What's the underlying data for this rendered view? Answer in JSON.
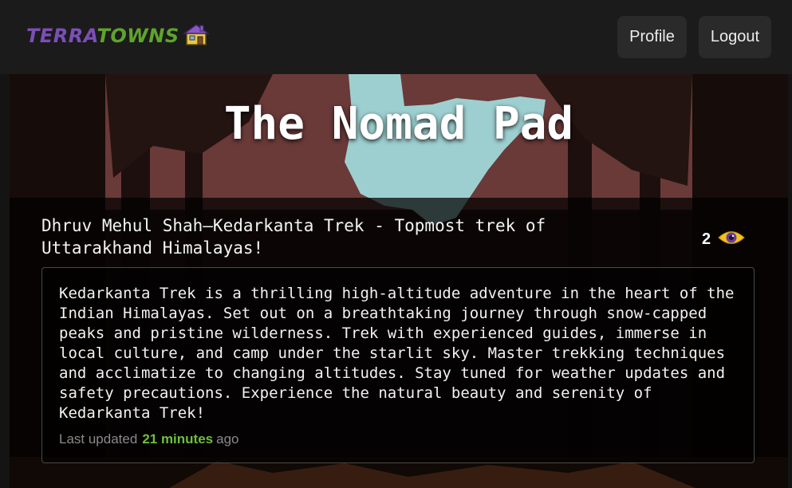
{
  "header": {
    "logo_part1": "TERRA",
    "logo_part2": "TOWNS",
    "logo_icon": "house-icon",
    "profile_label": "Profile",
    "logout_label": "Logout"
  },
  "home": {
    "title": "The Nomad Pad",
    "post_title": "Dhruv Mehul Shah—Kedarkanta Trek - Topmost trek of Uttarakhand Himalayas!",
    "views": "2",
    "views_icon": "eye-icon",
    "description": "Kedarkanta Trek is a thrilling high-altitude adventure in the heart of the Indian Himalayas. Set out on a breathtaking journey through snow-capped peaks and pristine wilderness. Trek with experienced guides, immerse in local culture, and camp under the starlit sky. Master trekking techniques and acclimatize to changing altitudes. Stay tuned for weather updates and safety precautions. Experience the natural beauty and serenity of Kedarkanta Trek!",
    "updated_prefix": "Last updated",
    "updated_value": "21 minutes",
    "updated_suffix": "ago"
  },
  "colors": {
    "logo_purple": "#7b4fb6",
    "logo_green": "#5fa32c",
    "accent_green": "#6fbf3a",
    "eye_yellow": "#f2c21b"
  }
}
